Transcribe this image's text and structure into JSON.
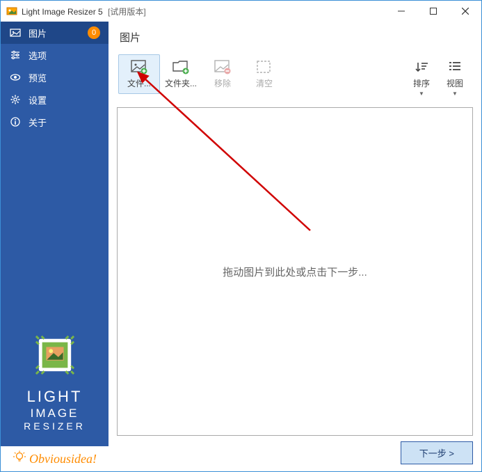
{
  "titlebar": {
    "app_name": "Light Image Resizer 5",
    "suffix": "[试用版本]"
  },
  "sidebar": {
    "items": [
      {
        "label": "图片",
        "badge": "0"
      },
      {
        "label": "选项"
      },
      {
        "label": "预览"
      },
      {
        "label": "设置"
      },
      {
        "label": "关于"
      }
    ],
    "logo_lines": {
      "l1": "LIGHT",
      "l2": "IMAGE",
      "l3": "RESIZER"
    },
    "obviousidea": "Obviousidea!"
  },
  "main": {
    "title": "图片",
    "toolbar": {
      "file": "文件...",
      "folder": "文件夹...",
      "remove": "移除",
      "clear": "清空",
      "sort": "排序",
      "view": "视图"
    },
    "drop_hint": "拖动图片到此处或点击下一步...",
    "next_button": "下一步 >"
  }
}
